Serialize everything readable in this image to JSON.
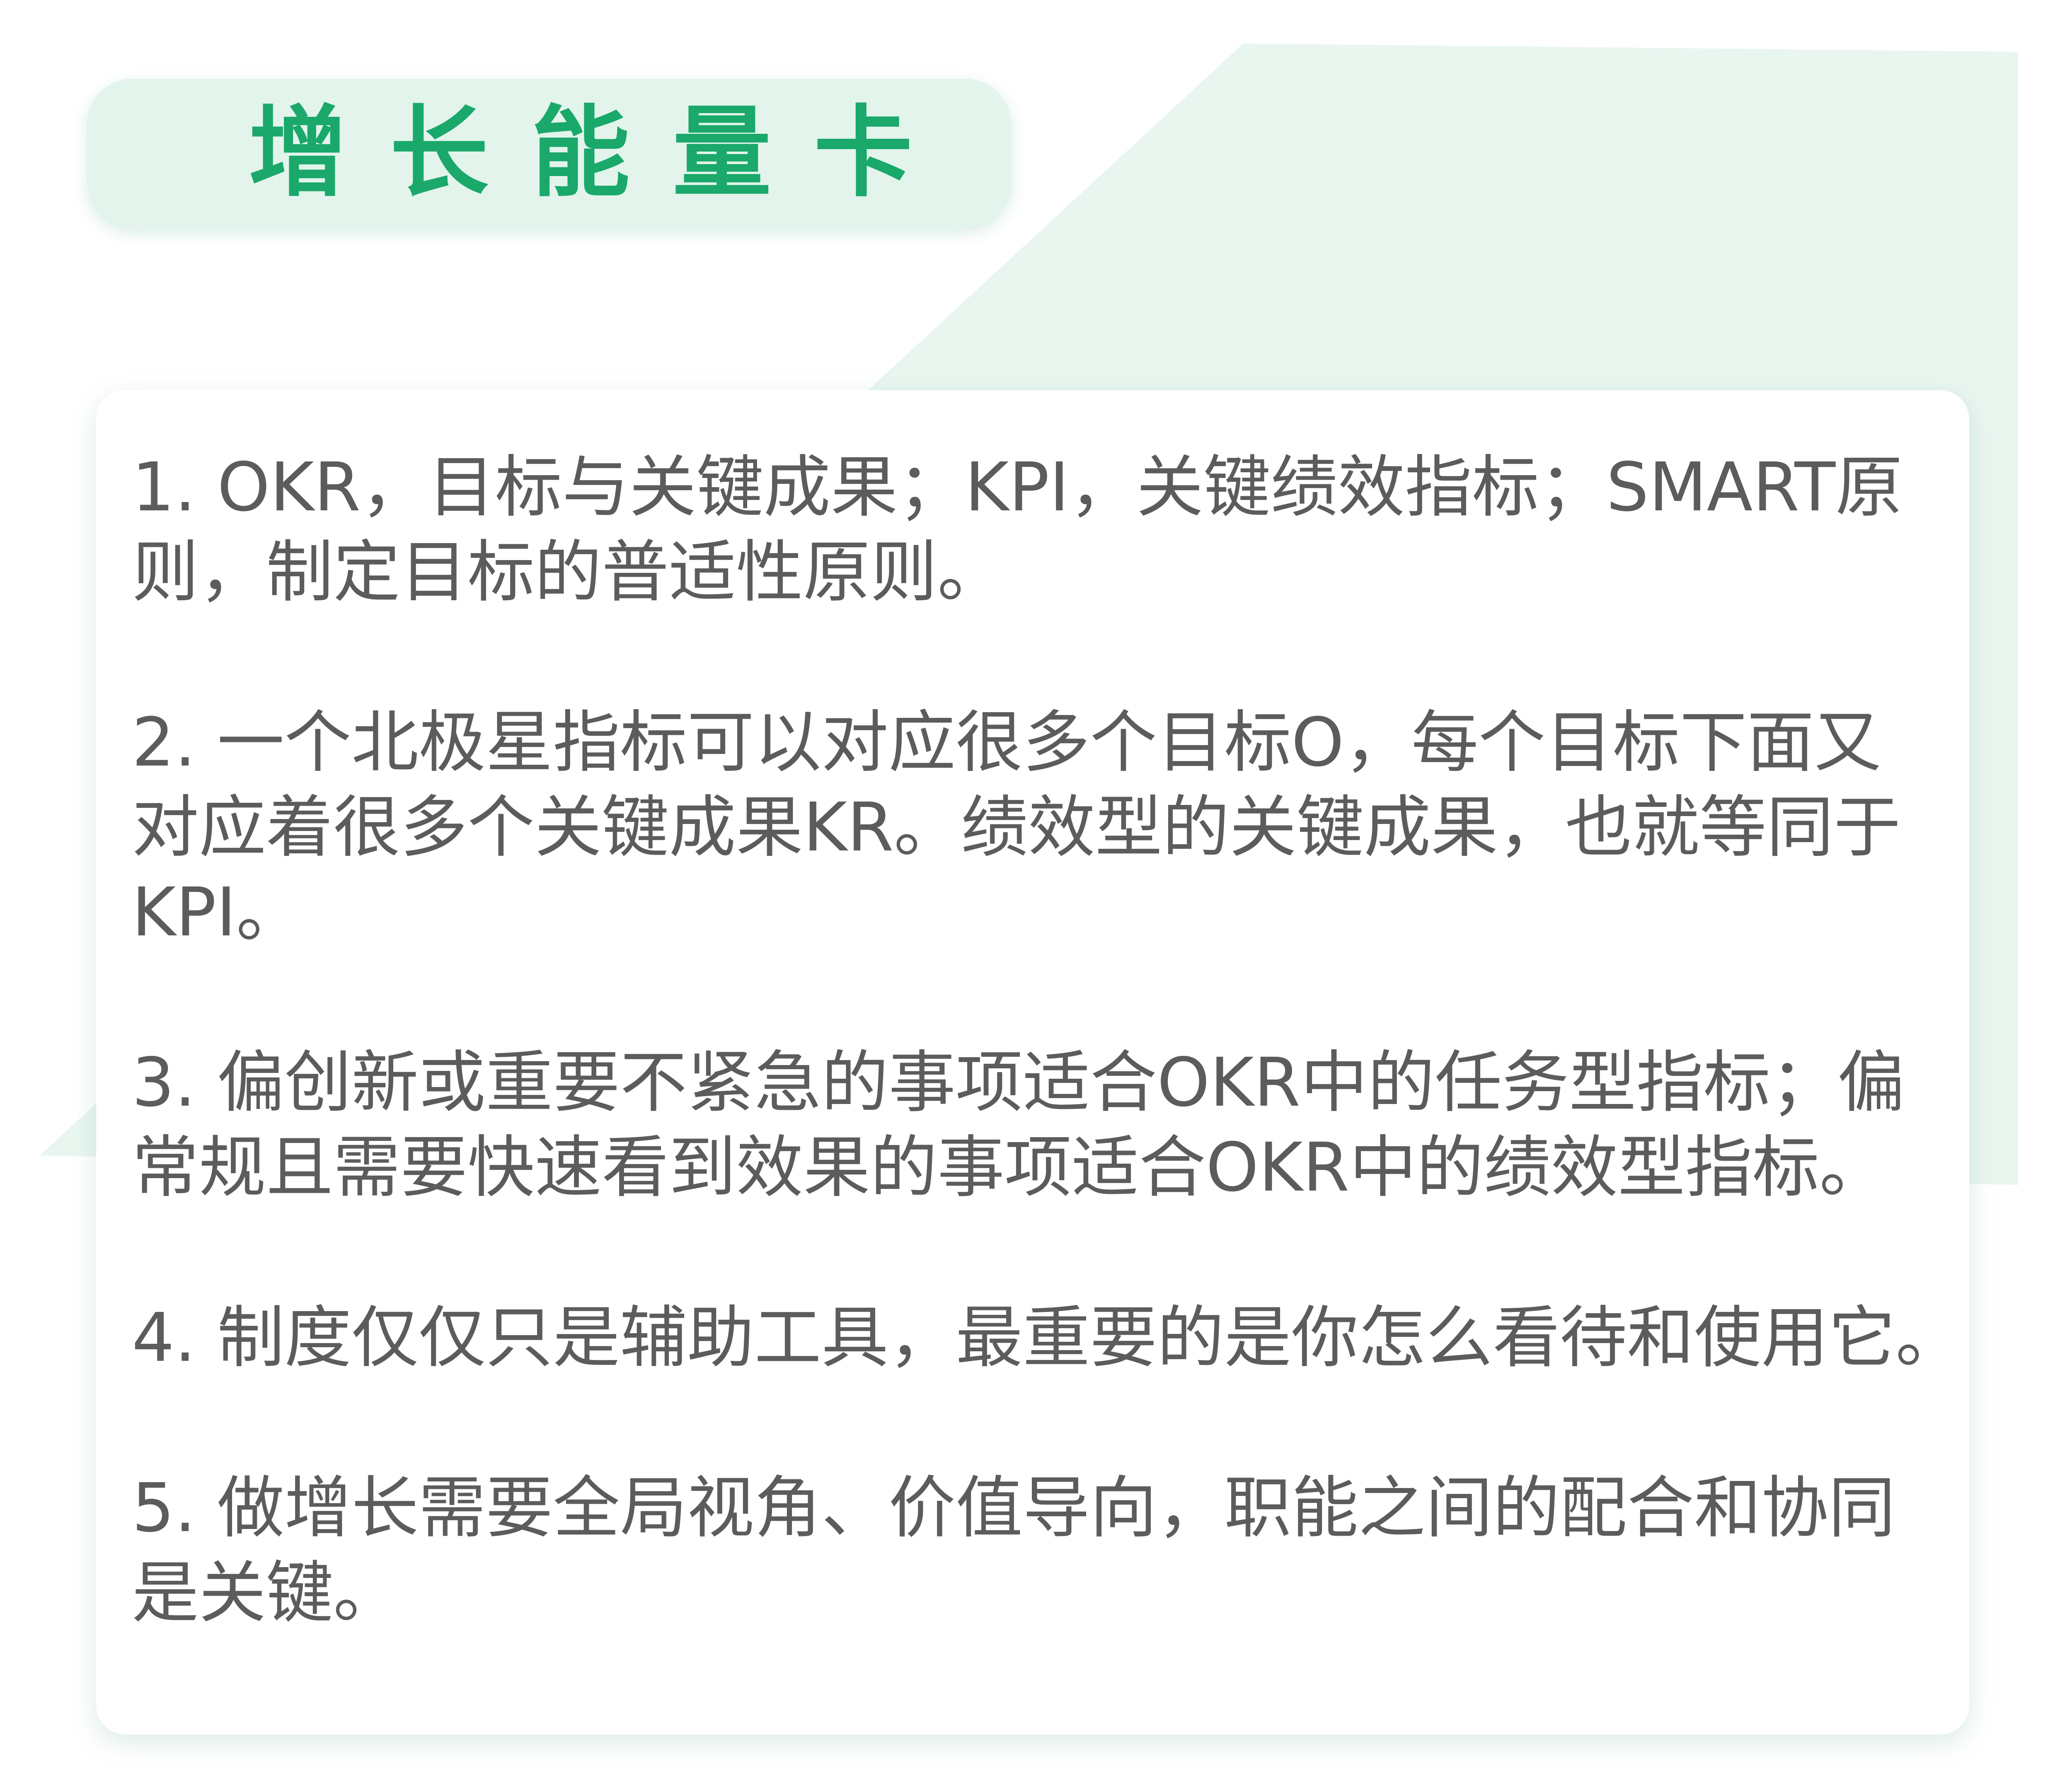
{
  "header": {
    "title": "增长能量卡"
  },
  "colors": {
    "accent": "#1aa86b",
    "title_background": "#e3f4ec",
    "decor_background": "#e9f6f0",
    "card_background": "#ffffff",
    "body_text": "#5c5c5c"
  },
  "card": {
    "items": [
      {
        "text": "1. OKR，目标与关键成果；KPI，关键绩效指标；SMART原\n则，制定目标的普适性原则。"
      },
      {
        "text": "2. 一个北极星指标可以对应很多个目标O，每个目标下面又\n对应着很多个关键成果KR。绩效型的关键成果，也就等同于\nKPI。"
      },
      {
        "text": "3. 偏创新或重要不紧急的事项适合OKR中的任务型指标；偏\n常规且需要快速看到效果的事项适合OKR中的绩效型指标。"
      },
      {
        "text": "4. 制度仅仅只是辅助工具，最重要的是你怎么看待和使用它。"
      },
      {
        "text": "5. 做增长需要全局视角、价值导向，职能之间的配合和协同\n是关键。"
      }
    ]
  }
}
